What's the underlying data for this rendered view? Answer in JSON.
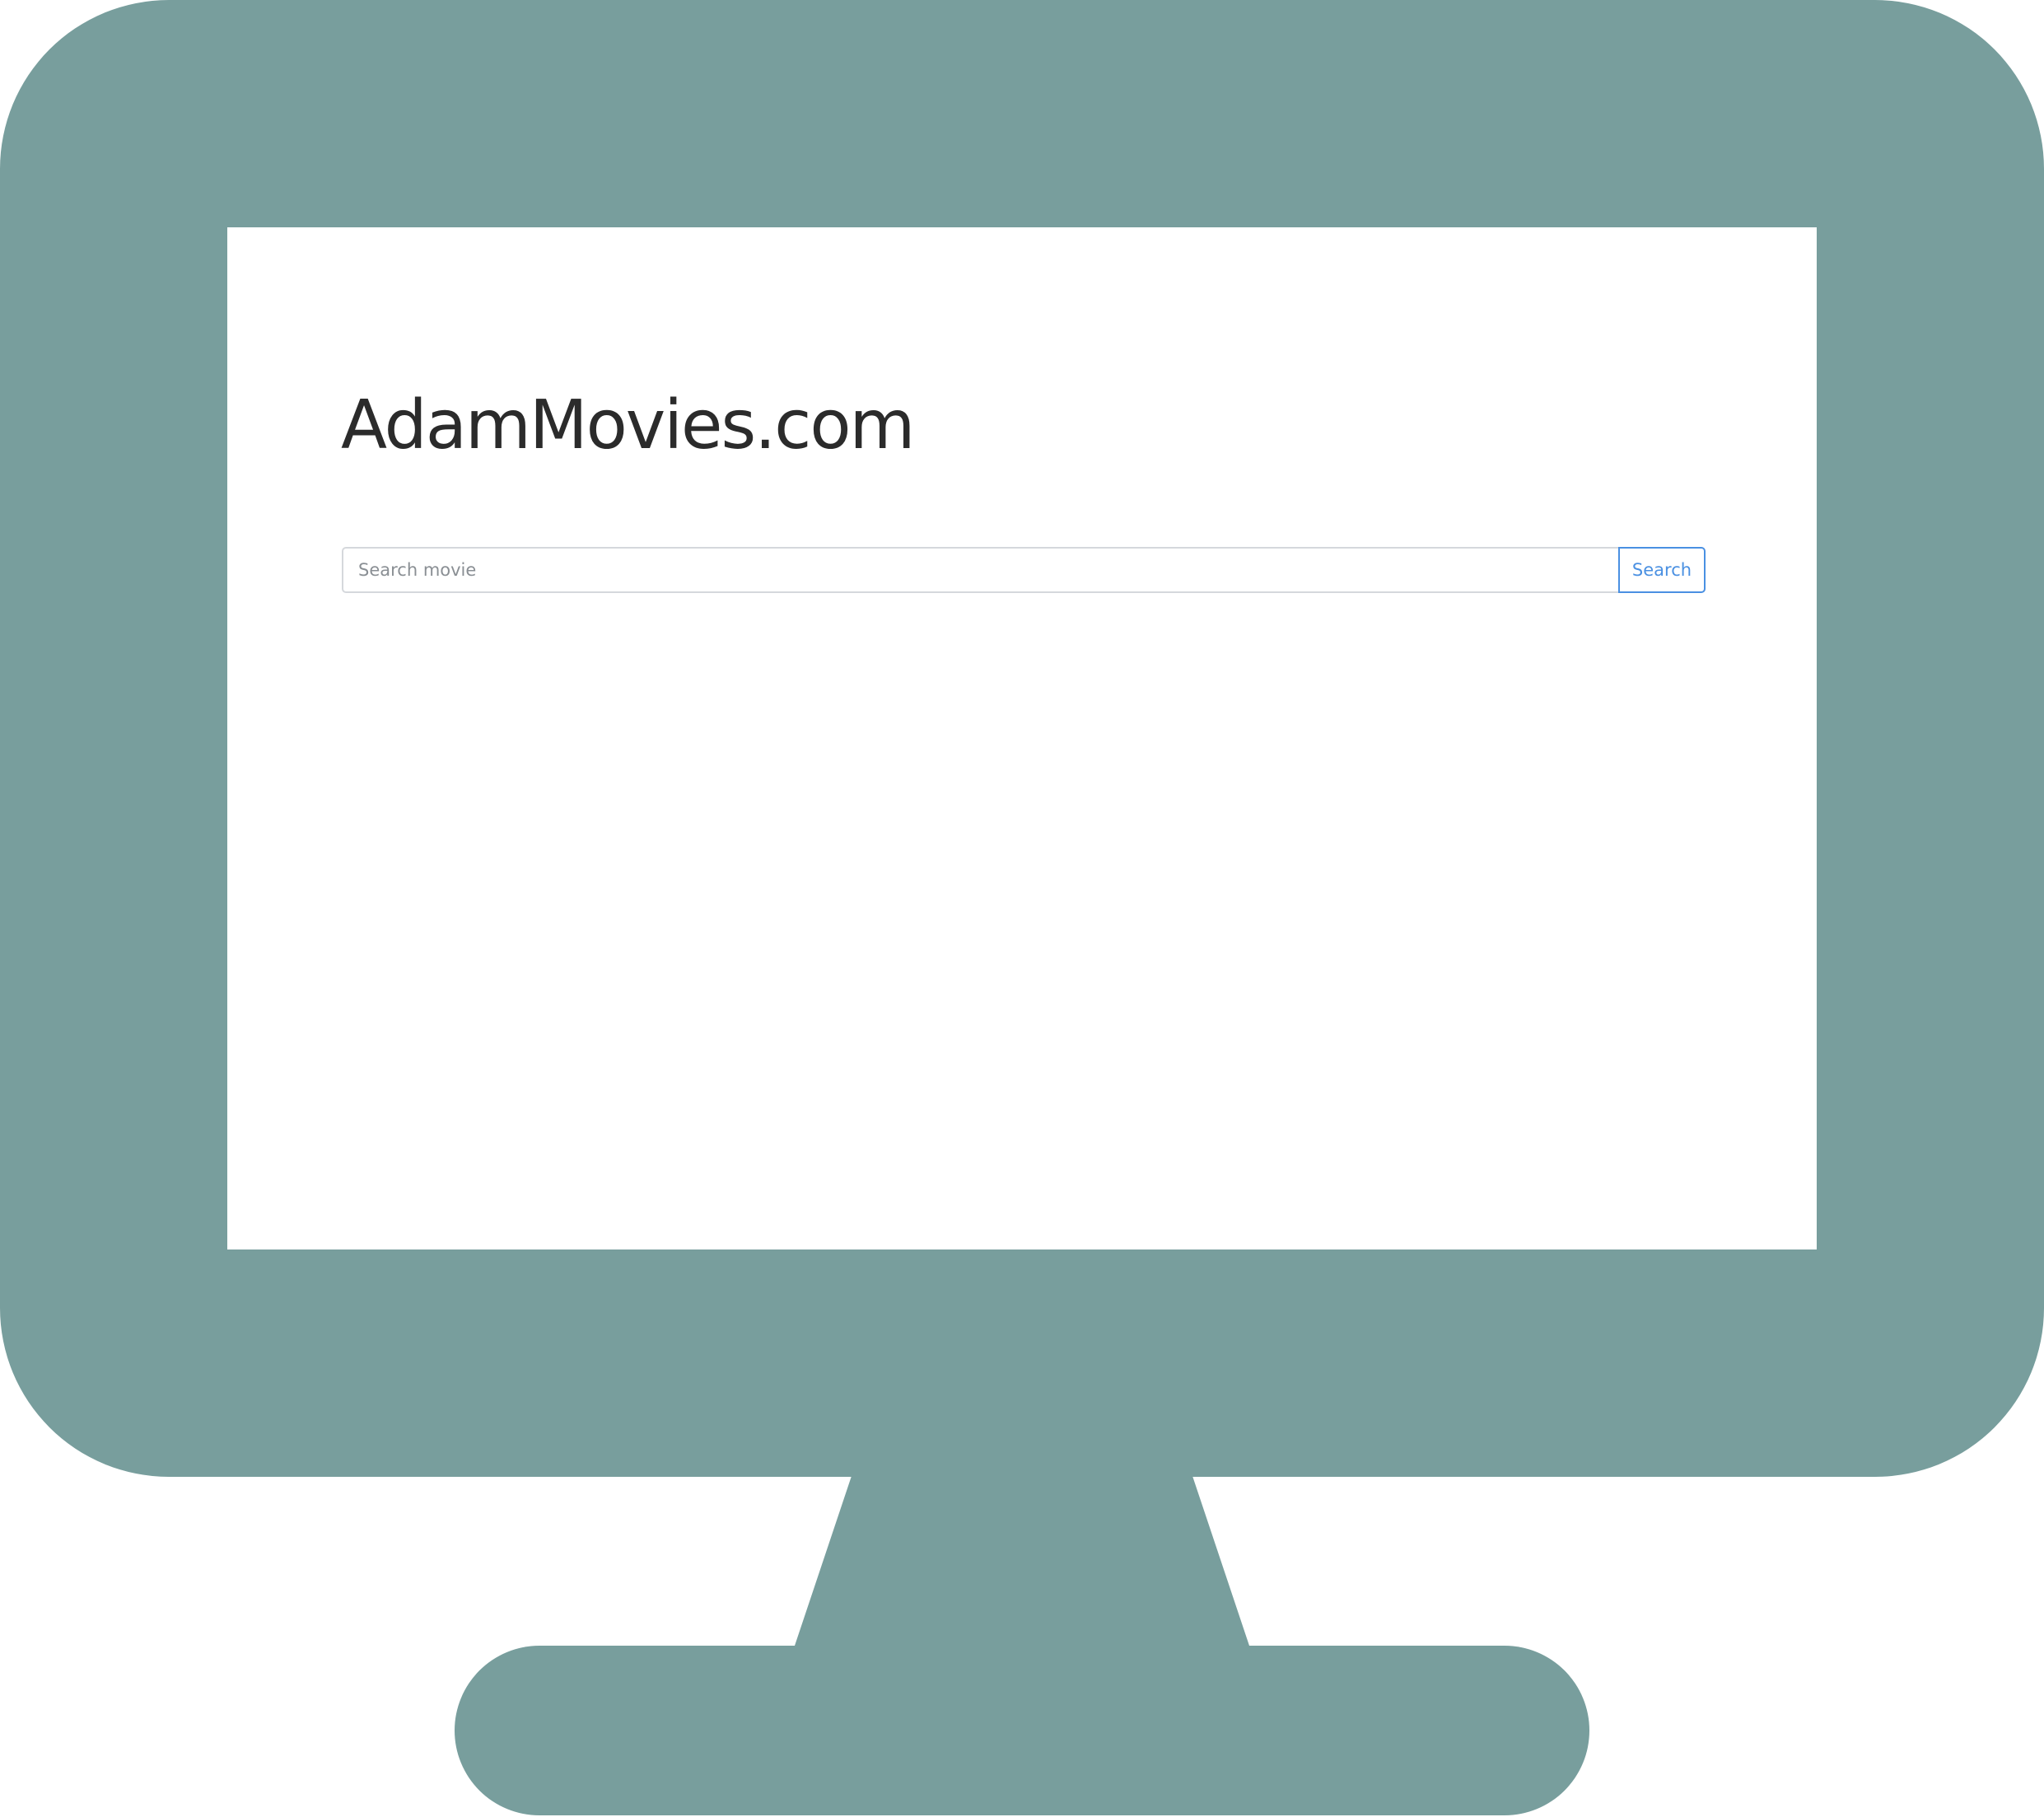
{
  "site": {
    "title": "AdamMovies.com"
  },
  "search": {
    "placeholder": "Search movie",
    "value": "",
    "button_label": "Search"
  },
  "colors": {
    "monitor_frame": "#789e9d",
    "screen_background": "#ffffff",
    "accent": "#4a90e2",
    "title_text": "#2b2b2b"
  },
  "icons": {
    "frame": "monitor-icon"
  }
}
